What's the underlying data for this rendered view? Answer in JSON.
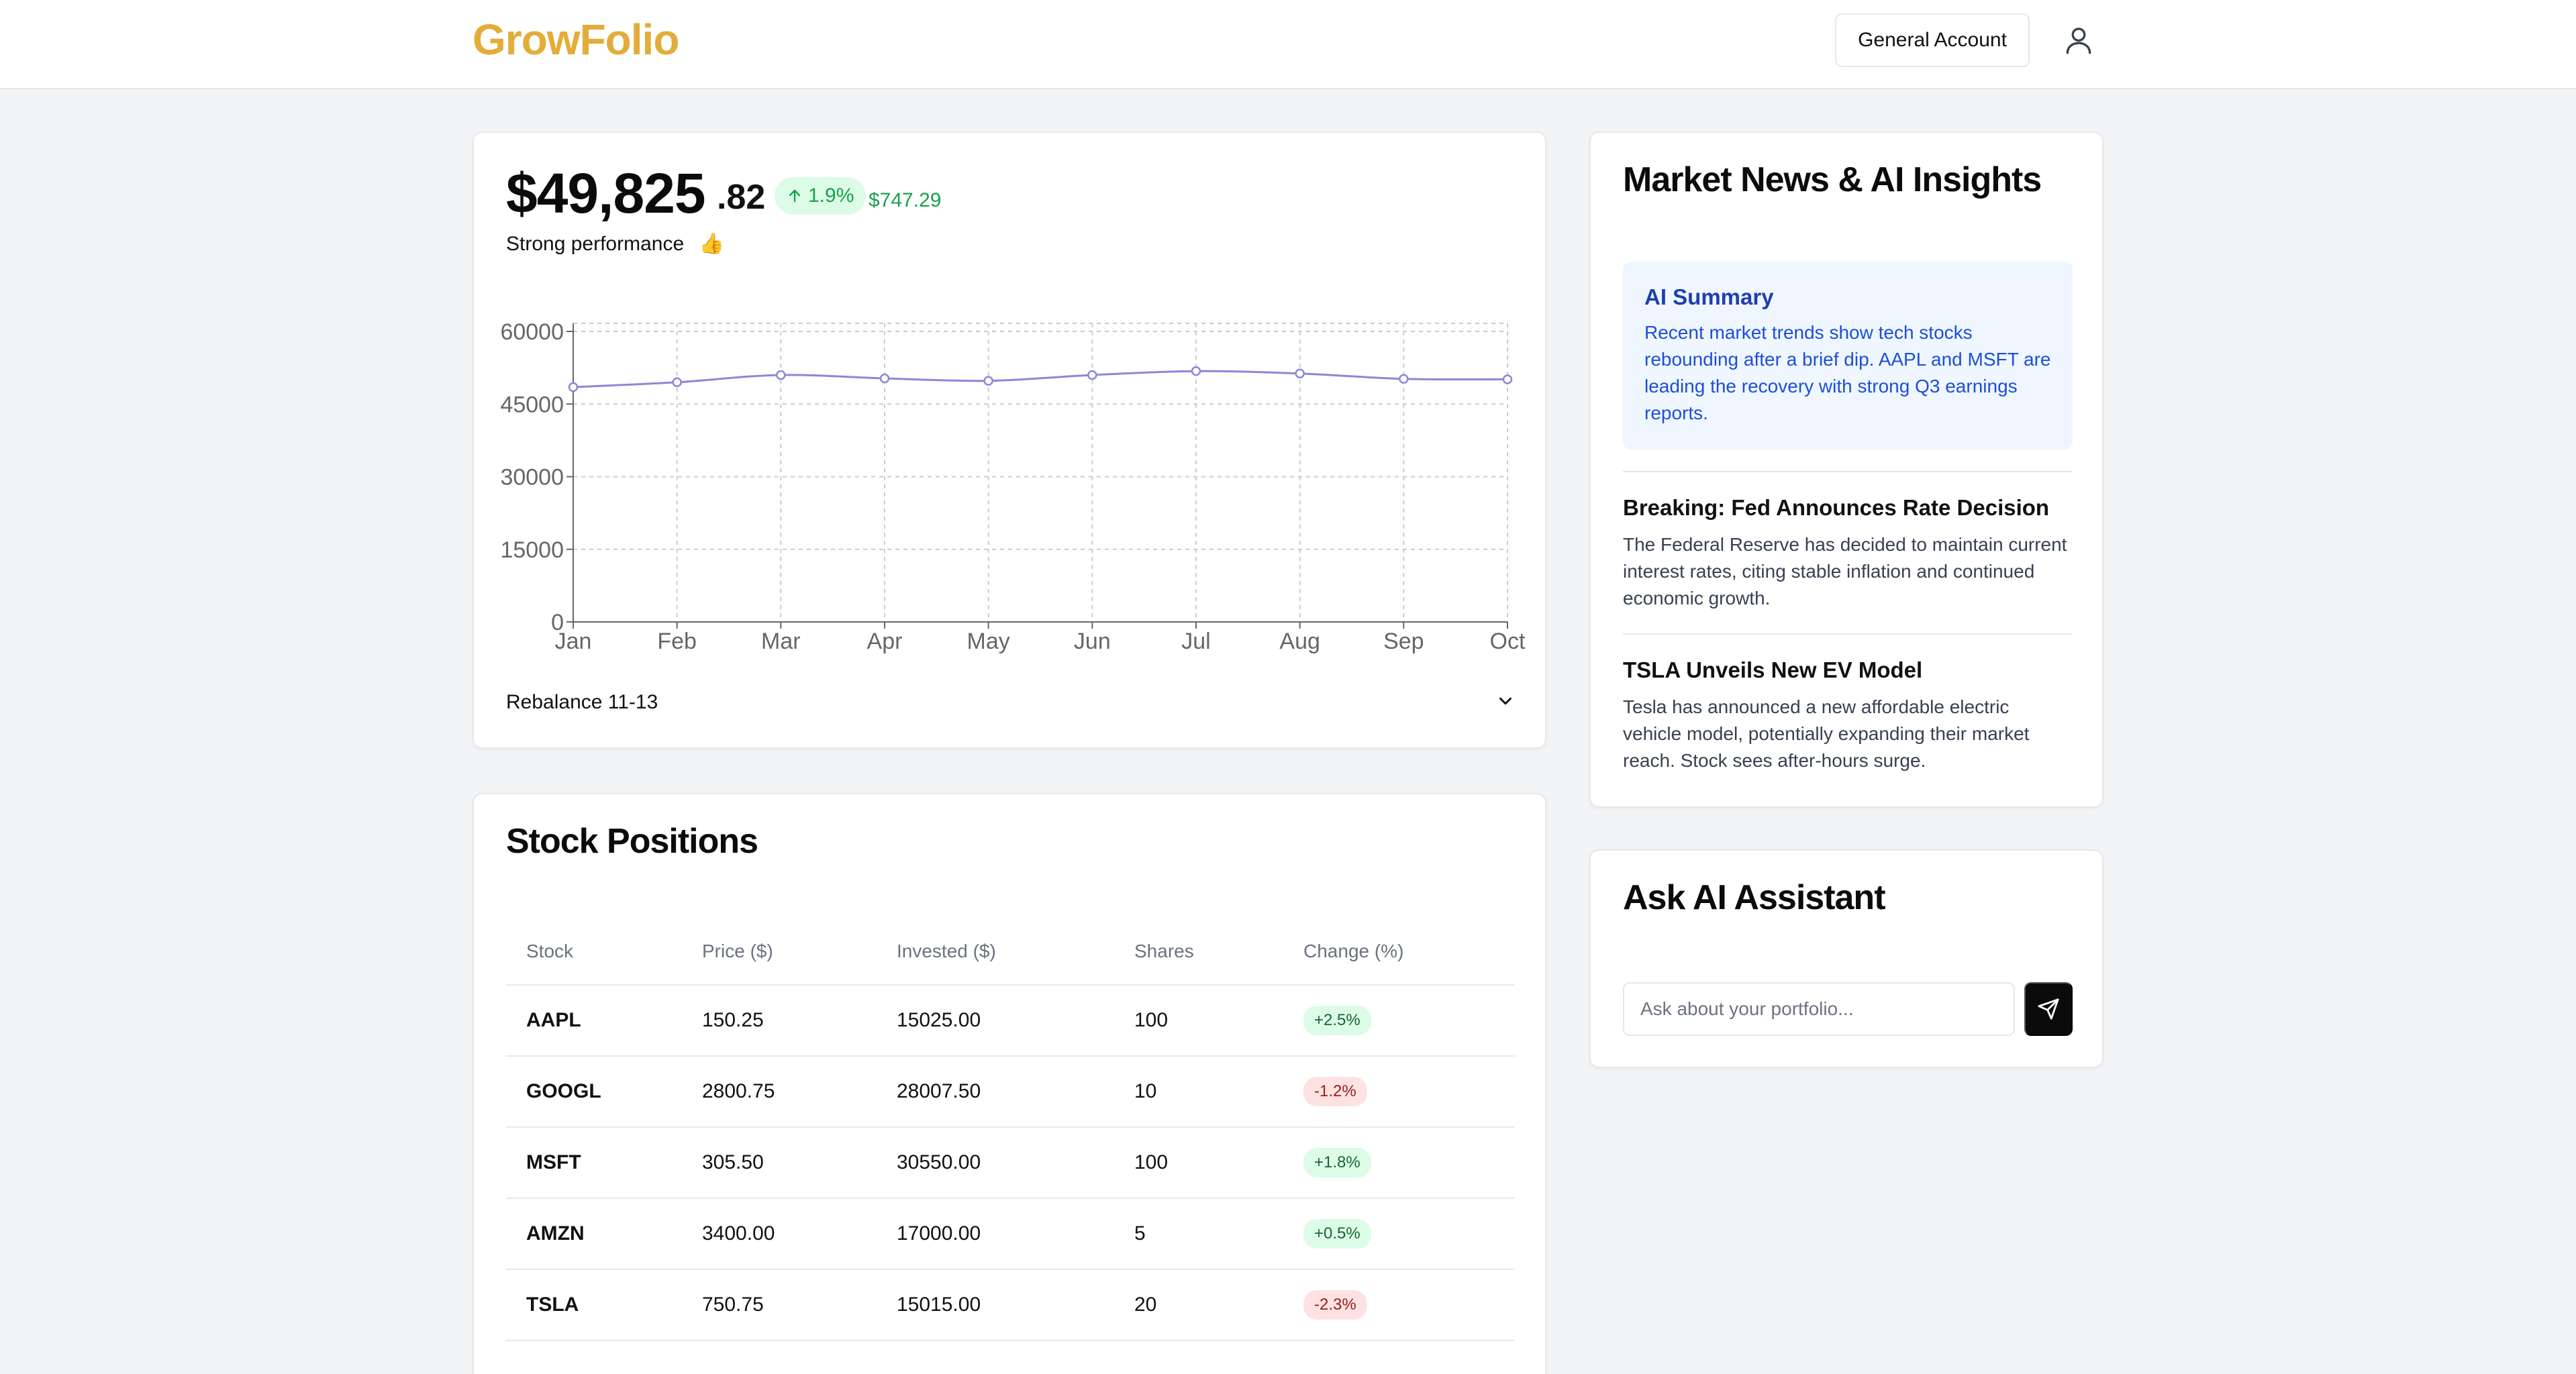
{
  "header": {
    "logo": "GrowFolio",
    "account_button": "General Account",
    "profile_icon": "user-icon"
  },
  "portfolio": {
    "balance_main": "$49,825",
    "balance_cents": ".82",
    "change_pct": "1.9%",
    "change_icon": "arrow-up-icon",
    "change_amount": "$747.29",
    "performance_text": "Strong performance",
    "performance_emoji": "👍",
    "rebalance_label": "Rebalance 11-13"
  },
  "chart_data": {
    "type": "line",
    "categories": [
      "Jan",
      "Feb",
      "Mar",
      "Apr",
      "May",
      "Jun",
      "Jul",
      "Aug",
      "Sep",
      "Oct"
    ],
    "values": [
      48500,
      49500,
      51000,
      50300,
      49800,
      51000,
      51800,
      51300,
      50200,
      50100
    ],
    "yticks": [
      0,
      15000,
      30000,
      45000,
      60000
    ],
    "ylim": [
      0,
      60000
    ],
    "grid": true,
    "line_color": "#8b87d6"
  },
  "stocks": {
    "title": "Stock Positions",
    "columns": [
      "Stock",
      "Price ($)",
      "Invested ($)",
      "Shares",
      "Change (%)"
    ],
    "rows": [
      {
        "symbol": "AAPL",
        "price": "150.25",
        "invested": "15025.00",
        "shares": "100",
        "change": "+2.5%",
        "direction": "pos"
      },
      {
        "symbol": "GOOGL",
        "price": "2800.75",
        "invested": "28007.50",
        "shares": "10",
        "change": "-1.2%",
        "direction": "neg"
      },
      {
        "symbol": "MSFT",
        "price": "305.50",
        "invested": "30550.00",
        "shares": "100",
        "change": "+1.8%",
        "direction": "pos"
      },
      {
        "symbol": "AMZN",
        "price": "3400.00",
        "invested": "17000.00",
        "shares": "5",
        "change": "+0.5%",
        "direction": "pos"
      },
      {
        "symbol": "TSLA",
        "price": "750.75",
        "invested": "15015.00",
        "shares": "20",
        "change": "-2.3%",
        "direction": "neg"
      }
    ]
  },
  "news": {
    "title": "Market News & AI Insights",
    "ai_summary_title": "AI Summary",
    "ai_summary_text": "Recent market trends show tech stocks rebounding after a brief dip. AAPL and MSFT are leading the recovery with strong Q3 earnings reports.",
    "items": [
      {
        "headline": "Breaking: Fed Announces Rate Decision",
        "body": "The Federal Reserve has decided to maintain current interest rates, citing stable inflation and continued economic growth."
      },
      {
        "headline": "TSLA Unveils New EV Model",
        "body": "Tesla has announced a new affordable electric vehicle model, potentially expanding their market reach. Stock sees after-hours surge."
      }
    ]
  },
  "assistant": {
    "title": "Ask AI Assistant",
    "input_placeholder": "Ask about your portfolio...",
    "input_value": "",
    "send_icon": "send-icon"
  },
  "colors": {
    "brand": "#e2ad38",
    "positive": "#16a34a",
    "negative": "#991b1b",
    "ai_accent": "#1d4ed8"
  }
}
